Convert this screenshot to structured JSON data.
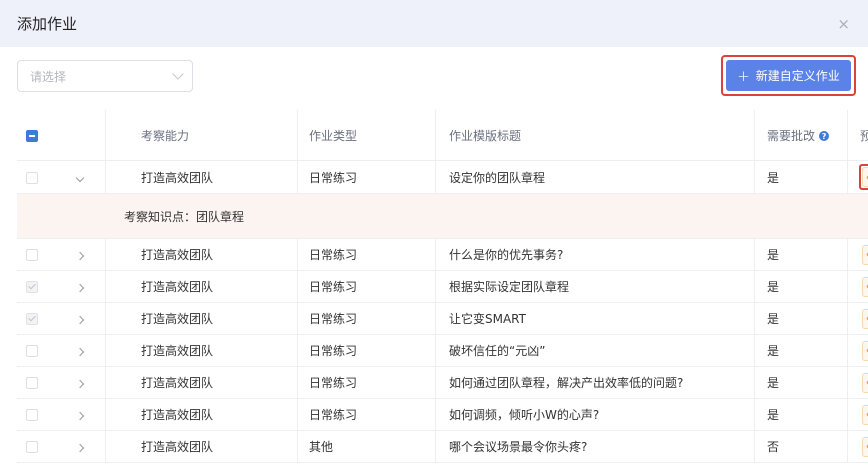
{
  "dialog": {
    "title": "添加作业",
    "close_icon": "×"
  },
  "filter": {
    "placeholder": "请选择"
  },
  "new_button": {
    "label": "新建自定义作业",
    "plus": "+"
  },
  "table": {
    "headers": {
      "ability": "考察能力",
      "type": "作业类型",
      "title": "作业模版标题",
      "review": "需要批改",
      "preview": "预览"
    },
    "help_icon": "?",
    "detail": "考察知识点：团队章程",
    "rows": [
      {
        "checked": false,
        "expanded": true,
        "ability": "打造高效团队",
        "type": "日常练习",
        "title": "设定你的团队章程",
        "review": "是"
      },
      {
        "checked": false,
        "expanded": false,
        "ability": "打造高效团队",
        "type": "日常练习",
        "title": "什么是你的优先事务?",
        "review": "是"
      },
      {
        "checked": true,
        "expanded": false,
        "ability": "打造高效团队",
        "type": "日常练习",
        "title": "根据实际设定团队章程",
        "review": "是"
      },
      {
        "checked": true,
        "expanded": false,
        "ability": "打造高效团队",
        "type": "日常练习",
        "title": "让它变SMART",
        "review": "是"
      },
      {
        "checked": false,
        "expanded": false,
        "ability": "打造高效团队",
        "type": "日常练习",
        "title": "破坏信任的“元凶”",
        "review": "是"
      },
      {
        "checked": false,
        "expanded": false,
        "ability": "打造高效团队",
        "type": "日常练习",
        "title": "如何通过团队章程，解决产出效率低的问题?",
        "review": "是"
      },
      {
        "checked": false,
        "expanded": false,
        "ability": "打造高效团队",
        "type": "日常练习",
        "title": "如何调频，倾听小W的心声?",
        "review": "是"
      },
      {
        "checked": false,
        "expanded": false,
        "ability": "打造高效团队",
        "type": "其他",
        "title": "哪个会议场景最令你头疼?",
        "review": "否"
      }
    ]
  },
  "colors": {
    "primary": "#5b82e6",
    "highlight": "#d9433a",
    "header_bg": "#eef1f9",
    "detail_bg": "#fcf4f1",
    "eye": "#e6a23c"
  }
}
